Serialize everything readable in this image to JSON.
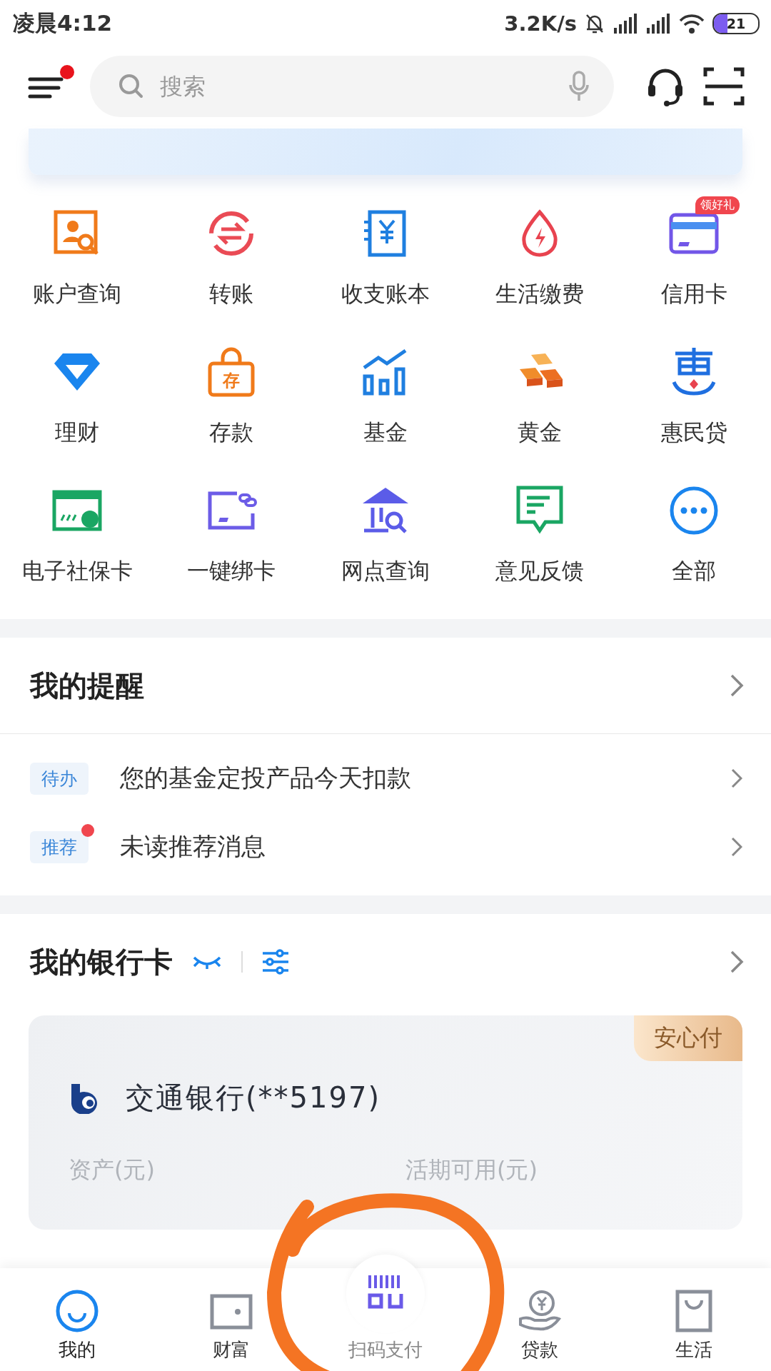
{
  "status_bar": {
    "time": "凌晨4:12",
    "net_speed": "3.2K/s",
    "battery": "21"
  },
  "header": {
    "menu_notification": true,
    "search": {
      "placeholder": "搜索"
    }
  },
  "services": [
    {
      "label": "账户查询"
    },
    {
      "label": "转账"
    },
    {
      "label": "收支账本"
    },
    {
      "label": "生活缴费"
    },
    {
      "label": "信用卡",
      "badge": "领好礼"
    },
    {
      "label": "理财"
    },
    {
      "label": "存款",
      "icon_text": "存"
    },
    {
      "label": "基金"
    },
    {
      "label": "黄金"
    },
    {
      "label": "惠民贷"
    },
    {
      "label": "电子社保卡"
    },
    {
      "label": "一键绑卡"
    },
    {
      "label": "网点查询"
    },
    {
      "label": "意见反馈"
    },
    {
      "label": "全部"
    }
  ],
  "reminders": {
    "title": "我的提醒",
    "items": [
      {
        "tag": "待办",
        "text": "您的基金定投产品今天扣款",
        "unread": false
      },
      {
        "tag": "推荐",
        "text": "未读推荐消息",
        "unread": true
      }
    ]
  },
  "bank_cards": {
    "title": "我的银行卡",
    "card": {
      "badge": "安心付",
      "bank": "交通银行(**5197)",
      "labels": [
        "资产(元)",
        "活期可用(元)"
      ]
    }
  },
  "bottom_nav": [
    {
      "label": "我的",
      "selected": true
    },
    {
      "label": "财富",
      "selected": false
    },
    {
      "label": "扫码支付",
      "selected": false
    },
    {
      "label": "贷款",
      "selected": false
    },
    {
      "label": "生活",
      "selected": false
    }
  ]
}
